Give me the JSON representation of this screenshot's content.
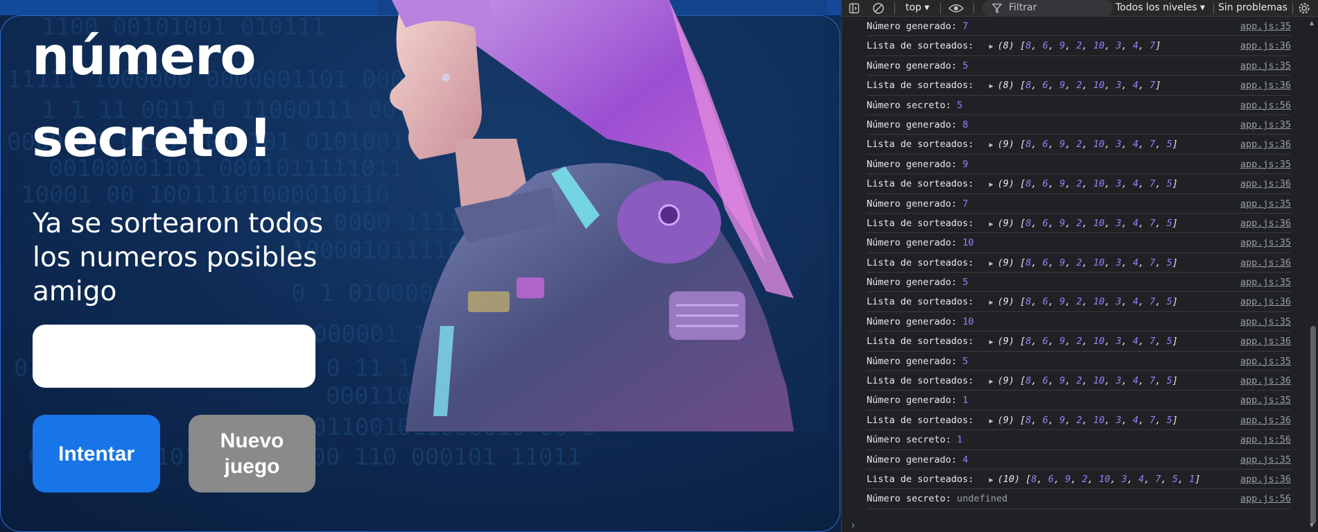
{
  "game": {
    "title_lines": [
      "número",
      "secreto!"
    ],
    "message": "Ya se sortearon todos los numeros posibles amigo",
    "input_value": "",
    "try_button": "Intentar",
    "new_game_button": "Nuevo juego"
  },
  "background_binary": [
    "1100 00101001 010111",
    "11111 1000000 0000001101 0001",
    "1 1 11 0011 0 11000111 0010",
    "0000100 0110 1000101 0101001",
    "00100001101 0001011111011",
    "10001 00 10011101000010110",
    "01 0000 1111111000",
    "1000010111100011",
    "0 1 0100001111 0 1",
    "110000001 101001010",
    "01 1100001 1100000 01 0 11 1",
    "0001100000111110100011 0",
    "0011001011000010 00 0",
    "01111 101101 001100000 110 000101 11011"
  ],
  "devtools": {
    "toolbar": {
      "context": "top",
      "filter_placeholder": "Filtrar",
      "levels": "Todos los niveles",
      "issues": "Sin problemas"
    },
    "logs": [
      {
        "label": "Número generado:",
        "value": "7",
        "source": "app.js:35"
      },
      {
        "label": "Lista de sorteados:",
        "count": "(8)",
        "array": [
          "8",
          "6",
          "9",
          "2",
          "10",
          "3",
          "4",
          "7"
        ],
        "source": "app.js:36"
      },
      {
        "label": "Número generado:",
        "value": "5",
        "source": "app.js:35"
      },
      {
        "label": "Lista de sorteados:",
        "count": "(8)",
        "array": [
          "8",
          "6",
          "9",
          "2",
          "10",
          "3",
          "4",
          "7"
        ],
        "source": "app.js:36"
      },
      {
        "label": "Número secreto:",
        "value": "5",
        "source": "app.js:56"
      },
      {
        "label": "Número generado:",
        "value": "8",
        "source": "app.js:35"
      },
      {
        "label": "Lista de sorteados:",
        "count": "(9)",
        "array": [
          "8",
          "6",
          "9",
          "2",
          "10",
          "3",
          "4",
          "7",
          "5"
        ],
        "source": "app.js:36"
      },
      {
        "label": "Número generado:",
        "value": "9",
        "source": "app.js:35"
      },
      {
        "label": "Lista de sorteados:",
        "count": "(9)",
        "array": [
          "8",
          "6",
          "9",
          "2",
          "10",
          "3",
          "4",
          "7",
          "5"
        ],
        "source": "app.js:36"
      },
      {
        "label": "Número generado:",
        "value": "7",
        "source": "app.js:35"
      },
      {
        "label": "Lista de sorteados:",
        "count": "(9)",
        "array": [
          "8",
          "6",
          "9",
          "2",
          "10",
          "3",
          "4",
          "7",
          "5"
        ],
        "source": "app.js:36"
      },
      {
        "label": "Número generado:",
        "value": "10",
        "source": "app.js:35"
      },
      {
        "label": "Lista de sorteados:",
        "count": "(9)",
        "array": [
          "8",
          "6",
          "9",
          "2",
          "10",
          "3",
          "4",
          "7",
          "5"
        ],
        "source": "app.js:36"
      },
      {
        "label": "Número generado:",
        "value": "5",
        "source": "app.js:35"
      },
      {
        "label": "Lista de sorteados:",
        "count": "(9)",
        "array": [
          "8",
          "6",
          "9",
          "2",
          "10",
          "3",
          "4",
          "7",
          "5"
        ],
        "source": "app.js:36"
      },
      {
        "label": "Número generado:",
        "value": "10",
        "source": "app.js:35"
      },
      {
        "label": "Lista de sorteados:",
        "count": "(9)",
        "array": [
          "8",
          "6",
          "9",
          "2",
          "10",
          "3",
          "4",
          "7",
          "5"
        ],
        "source": "app.js:36"
      },
      {
        "label": "Número generado:",
        "value": "5",
        "source": "app.js:35"
      },
      {
        "label": "Lista de sorteados:",
        "count": "(9)",
        "array": [
          "8",
          "6",
          "9",
          "2",
          "10",
          "3",
          "4",
          "7",
          "5"
        ],
        "source": "app.js:36"
      },
      {
        "label": "Número generado:",
        "value": "1",
        "source": "app.js:35"
      },
      {
        "label": "Lista de sorteados:",
        "count": "(9)",
        "array": [
          "8",
          "6",
          "9",
          "2",
          "10",
          "3",
          "4",
          "7",
          "5"
        ],
        "source": "app.js:36"
      },
      {
        "label": "Número secreto:",
        "value": "1",
        "source": "app.js:56"
      },
      {
        "label": "Número generado:",
        "value": "4",
        "source": "app.js:35"
      },
      {
        "label": "Lista de sorteados:",
        "count": "(10)",
        "array": [
          "8",
          "6",
          "9",
          "2",
          "10",
          "3",
          "4",
          "7",
          "5",
          "1"
        ],
        "source": "app.js:36"
      },
      {
        "label": "Número secreto:",
        "value": "undefined",
        "undefined": true,
        "source": "app.js:56"
      }
    ],
    "prompt": "›"
  }
}
